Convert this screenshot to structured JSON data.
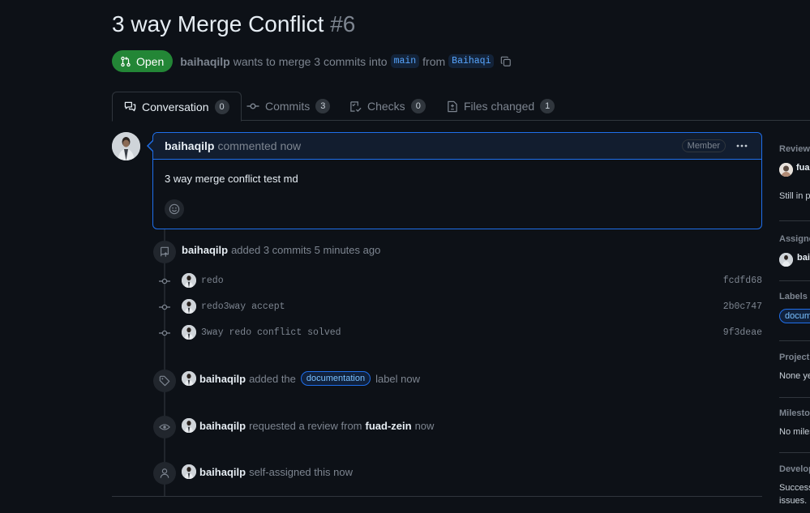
{
  "pr": {
    "title": "3 way Merge Conflict",
    "number": "#6",
    "state": "Open",
    "author": "baihaqilp",
    "merge_text": "wants to merge 3 commits into",
    "base_branch": "main",
    "from_text": "from",
    "head_branch": "Baihaqi"
  },
  "tabs": [
    {
      "label": "Conversation",
      "count": "0",
      "icon": "conversation-icon"
    },
    {
      "label": "Commits",
      "count": "3",
      "icon": "commit-icon"
    },
    {
      "label": "Checks",
      "count": "0",
      "icon": "checks-icon"
    },
    {
      "label": "Files changed",
      "count": "1",
      "icon": "file-diff-icon"
    }
  ],
  "comment": {
    "author": "baihaqilp",
    "when": "commented now",
    "role": "Member",
    "body": "3 way merge conflict test md"
  },
  "timeline": {
    "commits_event": {
      "author": "baihaqilp",
      "text": "added 3 commits 5 minutes ago"
    },
    "commits": [
      {
        "message": "redo",
        "sha": "fcdfd68"
      },
      {
        "message": "redo3way accept",
        "sha": "2b0c747"
      },
      {
        "message": "3way redo conflict solved",
        "sha": "9f3deae"
      }
    ],
    "label_event": {
      "author": "baihaqilp",
      "before": "added the",
      "label": "documentation",
      "after": "label now"
    },
    "review_event": {
      "author": "baihaqilp",
      "before": "requested a review from",
      "reviewer": "fuad-zein",
      "after": "now"
    },
    "assign_event": {
      "author": "baihaqilp",
      "text": "self-assigned this now"
    }
  },
  "sidebar": {
    "reviewers_heading": "Reviewe",
    "reviewer": "fua",
    "reviewer_status": "Still in p",
    "assignees_heading": "Assigne",
    "assignee": "bai",
    "labels_heading": "Labels",
    "label": "docum",
    "projects_heading": "Project",
    "projects_text": "None ye",
    "milestone_heading": "Milesto",
    "milestone_text": "No miles",
    "development_heading": "Develop",
    "development_text1": "Success",
    "development_text2": "issues."
  },
  "colors": {
    "background": "#0d1117",
    "open_green": "#238636",
    "accent_blue": "#1f6feb",
    "muted": "#7d8590"
  }
}
